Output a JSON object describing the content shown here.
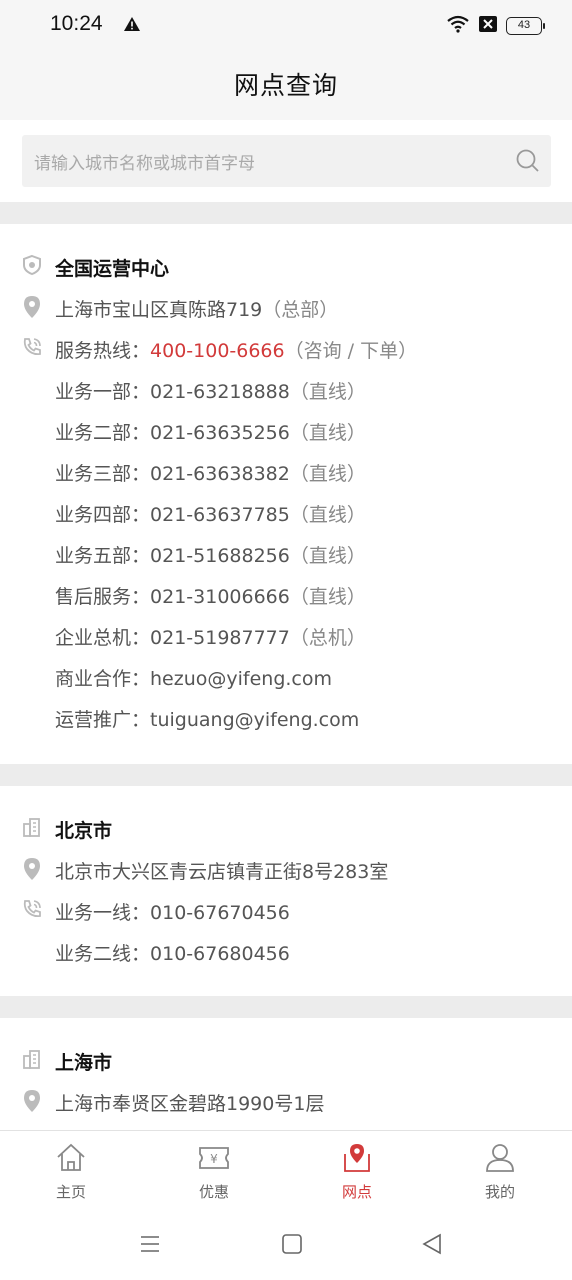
{
  "status_bar": {
    "time": "10:24",
    "battery": "43"
  },
  "header": {
    "title": "网点查询"
  },
  "search": {
    "placeholder": "请输入城市名称或城市首字母"
  },
  "hq": {
    "name": "全国运营中心",
    "address": "上海市宝山区真陈路719",
    "address_note": "（总部）",
    "hotline_label": "服务热线：",
    "hotline_number": "400-100-6666",
    "hotline_note": "（咨询 / 下单）",
    "lines": [
      {
        "label": "业务一部：",
        "value": "021-63218888",
        "note": "（直线）"
      },
      {
        "label": "业务二部：",
        "value": "021-63635256",
        "note": "（直线）"
      },
      {
        "label": "业务三部：",
        "value": "021-63638382",
        "note": "（直线）"
      },
      {
        "label": "业务四部：",
        "value": "021-63637785",
        "note": "（直线）"
      },
      {
        "label": "业务五部：",
        "value": "021-51688256",
        "note": "（直线）"
      },
      {
        "label": "售后服务：",
        "value": "021-31006666",
        "note": "（直线）"
      },
      {
        "label": "企业总机：",
        "value": "021-51987777",
        "note": "（总机）"
      },
      {
        "label": "商业合作：",
        "value": "hezuo@yifeng.com",
        "note": ""
      },
      {
        "label": "运营推广：",
        "value": "tuiguang@yifeng.com",
        "note": ""
      }
    ]
  },
  "beijing": {
    "name": "北京市",
    "address": "北京市大兴区青云店镇青正街8号283室",
    "lines": [
      {
        "label": "业务一线：",
        "value": "010-67670456"
      },
      {
        "label": "业务二线：",
        "value": "010-67680456"
      }
    ]
  },
  "shanghai": {
    "name": "上海市",
    "address": "上海市奉贤区金碧路1990号1层"
  },
  "tabs": [
    {
      "label": "主页",
      "icon": "home-icon"
    },
    {
      "label": "优惠",
      "icon": "coupon-icon"
    },
    {
      "label": "网点",
      "icon": "location-pin-icon"
    },
    {
      "label": "我的",
      "icon": "user-icon"
    }
  ],
  "colors": {
    "accent": "#d23a3a",
    "text": "#555555",
    "muted": "#888888",
    "divider": "#ececec"
  }
}
